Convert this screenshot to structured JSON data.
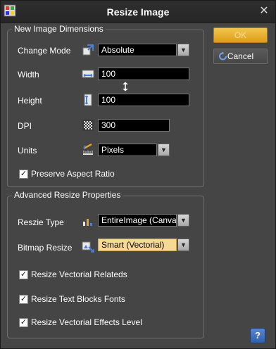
{
  "window": {
    "title": "Resize Image"
  },
  "dimensions": {
    "group_title": "New Image Dimensions",
    "change_mode": {
      "label": "Change Mode",
      "value": "Absolute",
      "icon": "change-mode-icon"
    },
    "width": {
      "label": "Width",
      "value": "100",
      "icon": "width-icon"
    },
    "height": {
      "label": "Height",
      "value": "100",
      "icon": "height-icon"
    },
    "dpi": {
      "label": "DPI",
      "value": "300",
      "icon": "dpi-icon"
    },
    "units": {
      "label": "Units",
      "value": "Pixels",
      "icon": "units-icon"
    },
    "preserve_aspect": {
      "label": "Preserve Aspect Ratio",
      "checked": true
    }
  },
  "advanced": {
    "group_title": "Advanced Resize Properties",
    "resize_type": {
      "label": "Reszie Type",
      "value": "EntireImage (Canvas)"
    },
    "bitmap_resize": {
      "label": "Bitmap Resize",
      "value": "Smart (Vectorial)"
    },
    "checks": [
      {
        "label": "Resize Vectorial Relateds",
        "checked": true
      },
      {
        "label": "Resize Text Blocks Fonts",
        "checked": true
      },
      {
        "label": "Resize Vectorial Effects Level",
        "checked": true
      }
    ]
  },
  "buttons": {
    "ok": "OK",
    "cancel": "Cancel",
    "help": "?"
  },
  "colors": {
    "accent_ok": "#e8ac2a",
    "highlight_field": "#f7d996",
    "background": "#454545"
  }
}
